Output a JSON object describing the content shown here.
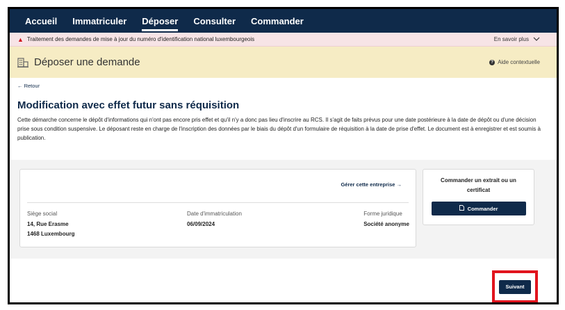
{
  "nav": {
    "items": [
      {
        "label": "Accueil",
        "active": false
      },
      {
        "label": "Immatriculer",
        "active": false
      },
      {
        "label": "Déposer",
        "active": true
      },
      {
        "label": "Consulter",
        "active": false
      },
      {
        "label": "Commander",
        "active": false
      }
    ]
  },
  "alert": {
    "text": "Traitement des demandes de mise à jour du numéro d'identification national luxembourgeois",
    "more_label": "En savoir plus"
  },
  "header": {
    "title": "Déposer une demande",
    "help_label": "Aide contextuelle"
  },
  "main": {
    "back_label": "← Retour",
    "title": "Modification avec effet futur sans réquisition",
    "description": "Cette démarche concerne le dépôt d'informations qui n'ont pas encore pris effet et qu'il n'y a donc pas lieu d'inscrire au RCS. Il s'agit de faits prévus pour une date postérieure à la date de dépôt ou d'une décision prise sous condition suspensive. Le déposant reste en charge de l'inscription des données par le biais du dépôt d'un formulaire de réquisition à la date de prise d'effet. Le document est à enregistrer et est soumis à publication."
  },
  "company_card": {
    "manage_label": "Gérer cette entreprise →",
    "seat_label": "Siège social",
    "seat_line1": "14, Rue Erasme",
    "seat_line2": "1468 Luxembourg",
    "reg_date_label": "Date d'immatriculation",
    "reg_date_value": "06/09/2024",
    "legal_form_label": "Forme juridique",
    "legal_form_value": "Société anonyme"
  },
  "order_card": {
    "title": "Commander un extrait ou un certificat",
    "button_label": "Commander"
  },
  "footer": {
    "next_label": "Suivant"
  },
  "colors": {
    "navy": "#0f2a4a",
    "alert_bg": "#f7e4e6",
    "header_bg": "#f6ecc4",
    "highlight": "#e1141d"
  }
}
